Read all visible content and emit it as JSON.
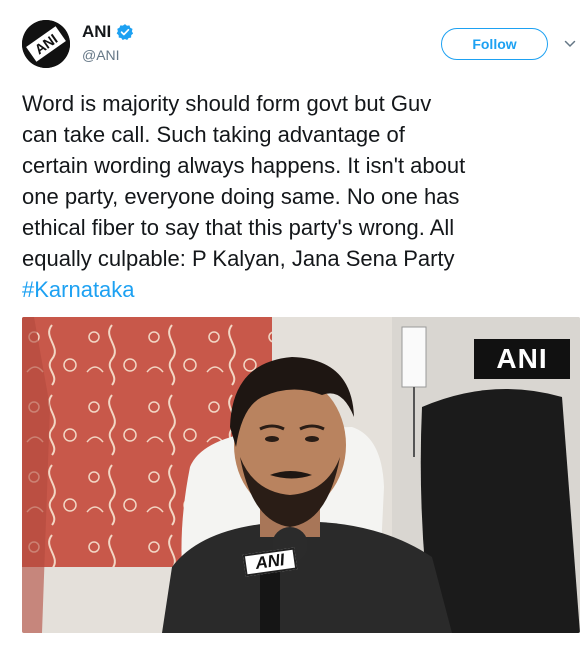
{
  "author": {
    "display_name": "ANI",
    "handle": "@ANI",
    "avatar_text": "ANI",
    "verified": true
  },
  "actions": {
    "follow_label": "Follow"
  },
  "tweet": {
    "lines": [
      "Word is majority should form govt but Guv",
      "can take call. Such taking advantage of",
      "certain wording always happens. It isn't about",
      "one party, everyone doing same. No one has",
      "ethical fiber to say that this party's wrong. All",
      "equally culpable: P Kalyan, Jana Sena Party"
    ],
    "hashtag": "#Karnataka"
  },
  "media": {
    "watermark": "ANI",
    "mic_label": "ANI"
  },
  "colors": {
    "accent": "#1da1f2",
    "text": "#14171a",
    "muted": "#657786"
  },
  "icons": {
    "verified": "verified-badge-icon",
    "caret": "chevron-down-icon"
  }
}
